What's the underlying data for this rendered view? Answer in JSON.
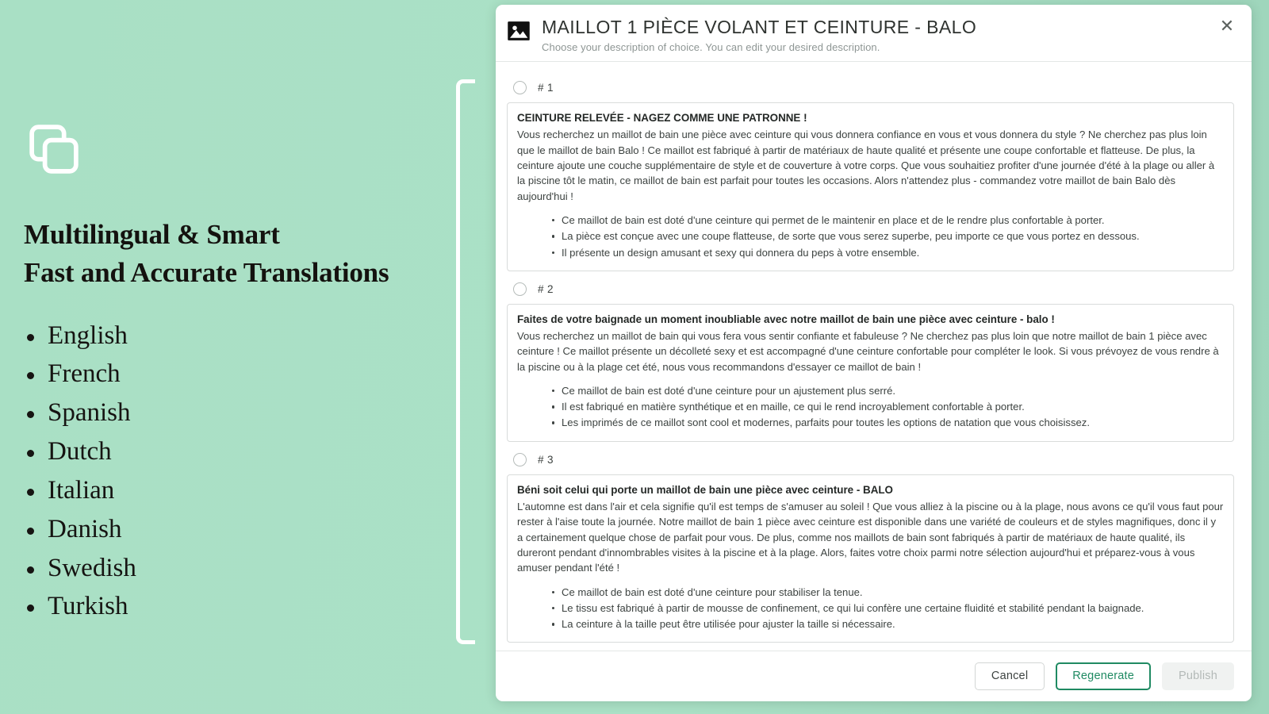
{
  "left_panel": {
    "icon": "copy-stack-icon",
    "headline_line1": "Multilingual & Smart",
    "headline_line2": "Fast and Accurate Translations",
    "languages": [
      "English",
      "French",
      "Spanish",
      "Dutch",
      "Italian",
      "Danish",
      "Swedish",
      "Turkish"
    ]
  },
  "modal": {
    "icon": "image-photo-icon",
    "title": "MAILLOT 1 PIÈCE VOLANT ET CEINTURE - BALO",
    "subtitle": "Choose your description of choice. You can edit your desired description.",
    "close_icon": "close-icon",
    "options": [
      {
        "label": "# 1",
        "selected": false,
        "title": "CEINTURE RELEVÉE - NAGEZ COMME UNE PATRONNE !",
        "body": "Vous recherchez un maillot de bain une pièce avec ceinture qui vous donnera confiance en vous et vous donnera du style ? Ne cherchez pas plus loin que le maillot de bain Balo ! Ce maillot est fabriqué à partir de matériaux de haute qualité et présente une coupe confortable et flatteuse. De plus, la ceinture ajoute une couche supplémentaire de style et de couverture à votre corps. Que vous souhaitiez profiter d'une journée d'été à la plage ou aller à la piscine tôt le matin, ce maillot de bain est parfait pour toutes les occasions. Alors n'attendez plus - commandez votre maillot de bain Balo dès aujourd'hui !",
        "bullets": [
          "Ce maillot de bain est doté d'une ceinture qui permet de le maintenir en place et de le rendre plus confortable à porter.",
          "La pièce est conçue avec une coupe flatteuse, de sorte que vous serez superbe, peu importe ce que vous portez en dessous.",
          "Il présente un design amusant et sexy qui donnera du peps à votre ensemble."
        ]
      },
      {
        "label": "# 2",
        "selected": false,
        "title": "Faites de votre baignade un moment inoubliable avec notre maillot de bain une pièce avec ceinture - balo !",
        "body": "Vous recherchez un maillot de bain qui vous fera vous sentir confiante et fabuleuse ? Ne cherchez pas plus loin que notre maillot de bain 1 pièce avec ceinture ! Ce maillot présente un décolleté sexy et est accompagné d'une ceinture confortable pour compléter le look. Si vous prévoyez de vous rendre à la piscine ou à la plage cet été, nous vous recommandons d'essayer ce maillot de bain !",
        "bullets": [
          "Ce maillot de bain est doté d'une ceinture pour un ajustement plus serré.",
          "Il est fabriqué en matière synthétique et en maille, ce qui le rend incroyablement confortable à porter.",
          "Les imprimés de ce maillot sont cool et modernes, parfaits pour toutes les options de natation que vous choisissez."
        ]
      },
      {
        "label": "# 3",
        "selected": false,
        "title": "Béni soit celui qui porte un maillot de bain une pièce avec ceinture - BALO",
        "body": "L'automne est dans l'air et cela signifie qu'il est temps de s'amuser au soleil ! Que vous alliez à la piscine ou à la plage, nous avons ce qu'il vous faut pour rester à l'aise toute la journée. Notre maillot de bain 1 pièce avec ceinture est disponible dans une variété de couleurs et de styles magnifiques, donc il y a certainement quelque chose de parfait pour vous. De plus, comme nos maillots de bain sont fabriqués à partir de matériaux de haute qualité, ils dureront pendant d'innombrables visites à la piscine et à la plage. Alors, faites votre choix parmi notre sélection aujourd'hui et préparez-vous à vous amuser pendant l'été !",
        "bullets": [
          "Ce maillot de bain est doté d'une ceinture pour stabiliser la tenue.",
          "Le tissu est fabriqué à partir de mousse de confinement, ce qui lui confère une certaine fluidité et stabilité pendant la baignade.",
          "La ceinture à la taille peut être utilisée pour ajuster la taille si nécessaire."
        ]
      }
    ],
    "footer": {
      "cancel_label": "Cancel",
      "regenerate_label": "Regenerate",
      "publish_label": "Publish"
    }
  },
  "colors": {
    "background_mint": "#a9e0c5",
    "accent_green": "#1f8a62",
    "modal_white": "#ffffff",
    "muted_text": "#8e9694"
  }
}
